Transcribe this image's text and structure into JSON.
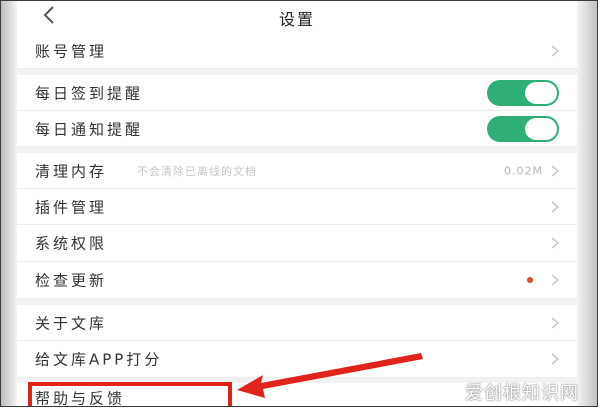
{
  "header": {
    "title": "设置"
  },
  "rows": {
    "account": {
      "label": "账号管理"
    },
    "checkin": {
      "label": "每日签到提醒",
      "enabled": true
    },
    "daily_notify": {
      "label": "每日通知提醒",
      "enabled": true
    },
    "clear_cache": {
      "label": "清理内存",
      "hint": "不会清除已离线的文档",
      "value": "0.02M"
    },
    "plugins": {
      "label": "插件管理"
    },
    "permissions": {
      "label": "系统权限"
    },
    "updates": {
      "label": "检查更新"
    },
    "about": {
      "label": "关于文库"
    },
    "rate": {
      "label": "给文库APP打分"
    },
    "help": {
      "label": "帮助与反馈"
    }
  },
  "annotation": {
    "highlight_color": "#e0241b"
  },
  "watermark": {
    "text": "爱创根知识网"
  },
  "colors": {
    "toggle_on": "#2fae76",
    "update_dot": "#e8432e"
  }
}
